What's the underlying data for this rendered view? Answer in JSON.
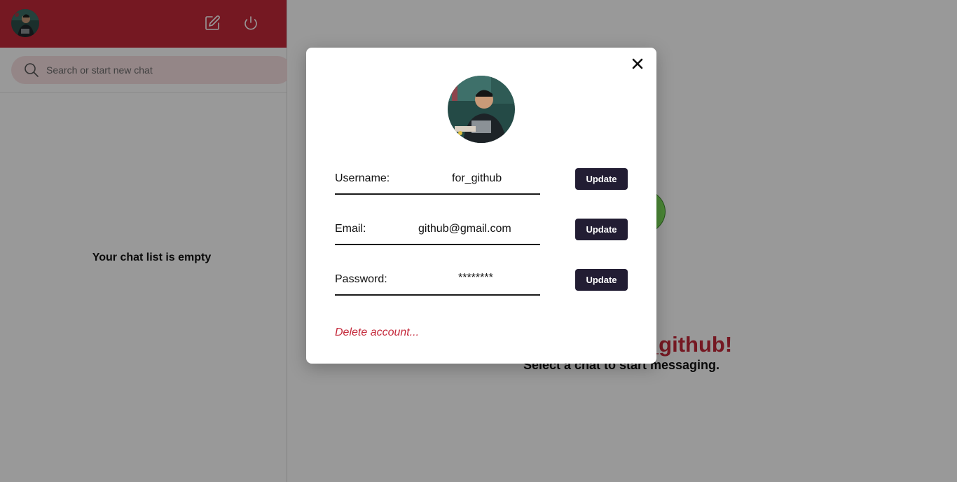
{
  "sidebar": {
    "search": {
      "placeholder": "Search or start new chat"
    },
    "empty_message": "Your chat list is empty",
    "header_icons": [
      "compose-icon",
      "power-icon"
    ]
  },
  "main": {
    "welcome_title": "Welcome, for_github!",
    "welcome_subtitle": "Select a chat to start messaging."
  },
  "profile_modal": {
    "fields": [
      {
        "label": "Username:",
        "value": "for_github",
        "button": "Update"
      },
      {
        "label": "Email:",
        "value": "github@gmail.com",
        "button": "Update"
      },
      {
        "label": "Password:",
        "value": "********",
        "button": "Update"
      }
    ],
    "delete_link": "Delete account..."
  },
  "colors": {
    "accent": "#c4283a",
    "button_dark": "#221d33",
    "search_bg": "#f7dfe2",
    "overlay": "rgba(0,0,0,0.40)"
  }
}
